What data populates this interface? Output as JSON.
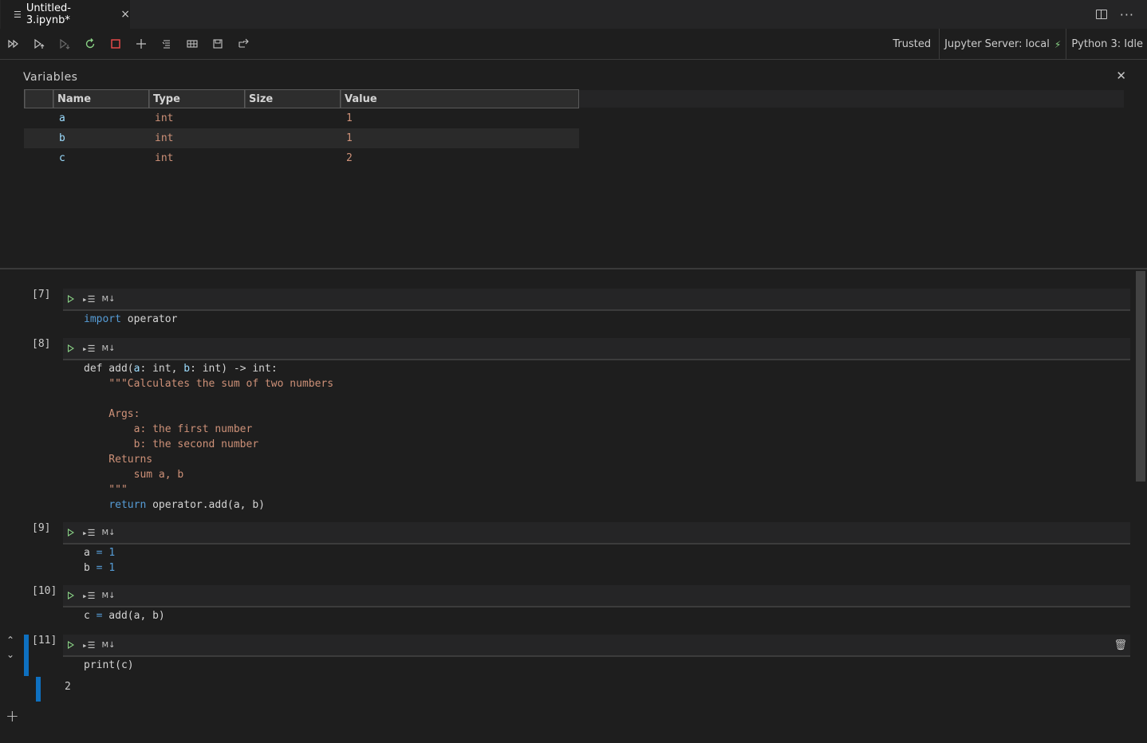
{
  "tab": {
    "icon": "list-icon",
    "title": "Untitled-3.ipynb*",
    "close": "×"
  },
  "toolbar": {
    "trusted": "Trusted",
    "server": "Jupyter Server: local",
    "kernel": "Python 3: Idle"
  },
  "variables": {
    "title": "Variables",
    "columns": [
      "Name",
      "Type",
      "Size",
      "Value"
    ],
    "rows": [
      {
        "name": "a",
        "type": "int",
        "size": "",
        "value": "1"
      },
      {
        "name": "b",
        "type": "int",
        "size": "",
        "value": "1"
      },
      {
        "name": "c",
        "type": "int",
        "size": "",
        "value": "2"
      }
    ]
  },
  "cells": [
    {
      "count": "[7]"
    },
    {
      "count": "[8]"
    },
    {
      "count": "[9]"
    },
    {
      "count": "[10]"
    },
    {
      "count": "[11]",
      "output": "2"
    }
  ],
  "markdown_label": "M↓"
}
